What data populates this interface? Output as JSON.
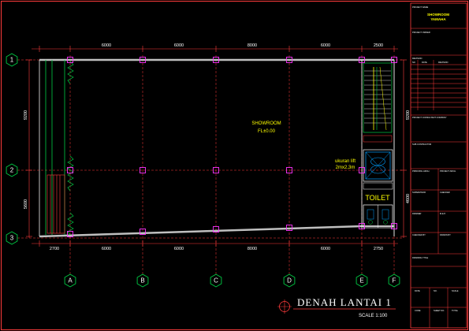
{
  "plan": {
    "title": "DENAH LANTAI  1",
    "scale": "SCALE 1:100",
    "room_label": "SHOWROOM",
    "room_level": "FL±0.00",
    "lift_label": "ukuran lift",
    "lift_size": "2mx2,3m",
    "toilet_label": "TOILET"
  },
  "grid": {
    "rows": [
      "1",
      "2",
      "3"
    ],
    "cols": [
      "A",
      "B",
      "C",
      "D",
      "E",
      "F"
    ]
  },
  "dimensions": {
    "top": [
      "6000",
      "6000",
      "8000",
      "6000",
      "2500"
    ],
    "bottom": [
      "2700",
      "6000",
      "6000",
      "8000",
      "6000",
      "2750"
    ],
    "left": [
      "9200",
      "5600"
    ],
    "right": [
      "9200",
      "4600"
    ]
  },
  "title_block": {
    "project_name_label": "PROJECT NAME",
    "project_name_value": "SHOWROOM\nYAMAHA",
    "project_owner_label": "PROJECT OWNER",
    "revision_label": "REVISION",
    "revision_cols": [
      "NO",
      "DATE",
      "REVISION"
    ],
    "project_consultant_label": "PROJECT CONSULTANT COMPANY",
    "sub_contractor_label": "SUB CONTRACTOR",
    "sign_cells": [
      "PRINCIPAL ARCH.",
      "PROJECT ARCH.",
      "SUPERVISOR",
      "CHECKER",
      "DRAWER",
      "M.E.P.",
      "CHECKED BY",
      "DRAWN BY"
    ],
    "drawing_title_label": "DRAWING TITLE",
    "footer_cells": [
      "DATE",
      "NO.",
      "SCALE",
      "CODE",
      "SHEET NO.",
      "TOTAL"
    ]
  }
}
